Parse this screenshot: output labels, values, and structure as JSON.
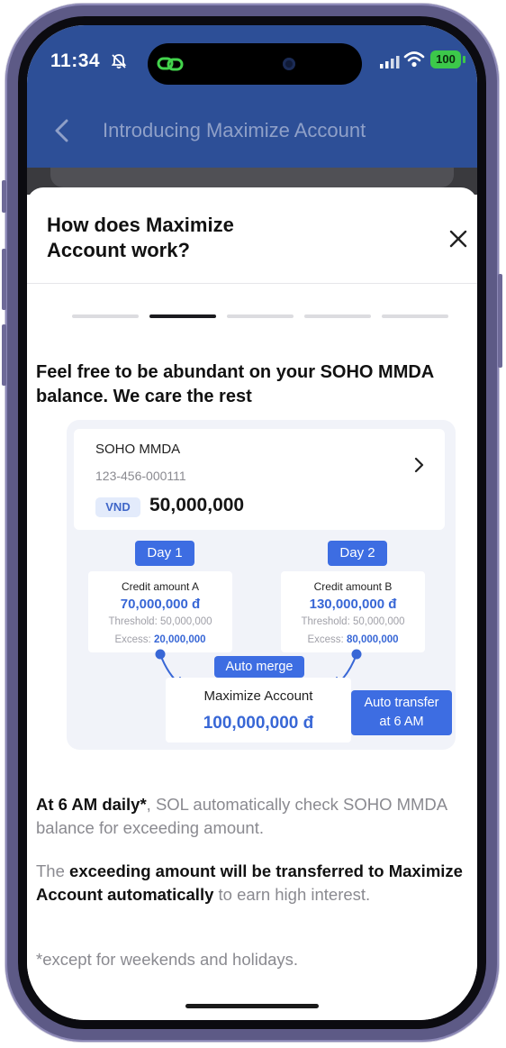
{
  "status_bar": {
    "time": "11:34",
    "battery": "100",
    "icons": [
      "bell-slash-icon",
      "signal-icon",
      "wifi-icon",
      "battery-icon"
    ]
  },
  "nav": {
    "title": "Introducing Maximize Account",
    "back_icon": "chevron-left-icon"
  },
  "sheet": {
    "title": "How does Maximize Account work?",
    "close_icon": "close-icon",
    "steps_total": 5,
    "active_step": 2,
    "headline": "Feel free to be abundant on your SOHO MMDA balance. We care the rest"
  },
  "illustration": {
    "account": {
      "name": "SOHO MMDA",
      "number": "123-456-000111",
      "currency": "VND",
      "balance": "50,000,000"
    },
    "days": [
      {
        "tag": "Day 1",
        "label": "Credit amount A",
        "amount": "70,000,000 đ",
        "threshold_label": "Threshold:",
        "threshold": "50,000,000",
        "excess_label": "Excess:",
        "excess": "20,000,000"
      },
      {
        "tag": "Day 2",
        "label": "Credit amount B",
        "amount": "130,000,000 đ",
        "threshold_label": "Threshold:",
        "threshold": "50,000,000",
        "excess_label": "Excess:",
        "excess": "80,000,000"
      }
    ],
    "merge_tag": "Auto merge",
    "maximize": {
      "label": "Maximize Account",
      "amount": "100,000,000 đ"
    },
    "auto_transfer": {
      "line1": "Auto transfer",
      "line2": "at 6 AM"
    }
  },
  "body": {
    "p1_bold": "At 6 AM daily*",
    "p1_rest": ", SOL automatically check SOHO MMDA balance for exceeding amount.",
    "p2_pre": "The ",
    "p2_bold": "exceeding amount will be transferred to Maximize Account automatically",
    "p2_rest": " to earn high interest.",
    "footnote": "*except for weekends and holidays."
  },
  "colors": {
    "brand_blue": "#2d4f97",
    "accent_blue": "#3d6de2",
    "amount_blue": "#3867d6"
  }
}
